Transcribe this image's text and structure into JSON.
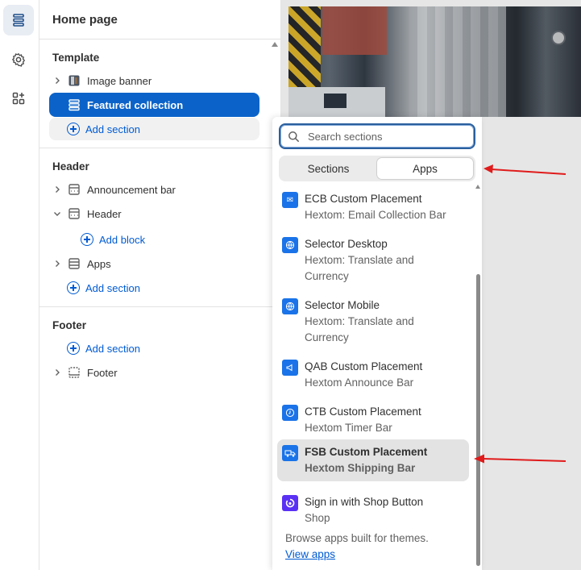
{
  "panel": {
    "title": "Home page",
    "template_group": "Template",
    "template_items": [
      {
        "label": "Image banner",
        "icon": "image-thumbnail-icon"
      },
      {
        "label": "Featured collection",
        "icon": "collection-section-icon",
        "selected": true
      }
    ],
    "add_section_label": "Add section",
    "header_group": "Header",
    "header_items": [
      {
        "label": "Announcement bar",
        "icon": "section-icon"
      },
      {
        "label": "Header",
        "icon": "section-icon"
      },
      {
        "label": "Apps",
        "icon": "apps-section-icon"
      }
    ],
    "add_block_label": "Add block",
    "footer_group": "Footer",
    "footer_items": [
      {
        "label": "Footer",
        "icon": "footer-section-icon"
      }
    ]
  },
  "popover": {
    "search_placeholder": "Search sections",
    "tabs": [
      {
        "label": "Sections",
        "active": false
      },
      {
        "label": "Apps",
        "active": true
      }
    ],
    "apps": [
      {
        "name": "ECB Custom Placement",
        "sub": "Hextom: Email Collection Bar",
        "icon": "mail-icon"
      },
      {
        "name": "Selector Desktop",
        "sub_line1": "Hextom: Translate and",
        "sub_line2": "Currency",
        "icon": "globe-icon"
      },
      {
        "name": "Selector Mobile",
        "sub_line1": "Hextom: Translate and",
        "sub_line2": "Currency",
        "icon": "globe-icon"
      },
      {
        "name": "QAB Custom Placement",
        "sub": "Hextom Announce Bar",
        "icon": "megaphone-icon"
      },
      {
        "name": "CTB Custom Placement",
        "sub": "Hextom Timer Bar",
        "icon": "clock-icon"
      },
      {
        "name": "FSB Custom Placement",
        "sub": "Hextom Shipping Bar",
        "icon": "truck-icon",
        "highlighted": true
      },
      {
        "name": "Sign in with Shop Button",
        "sub": "Shop",
        "icon": "shop-icon"
      }
    ],
    "footer_note": "Browse apps built for themes.",
    "footer_link": "View apps"
  },
  "colors": {
    "accent": "#005bd3",
    "selected_bg": "#0b63c9",
    "annotation_arrow": "#e01b1b"
  }
}
